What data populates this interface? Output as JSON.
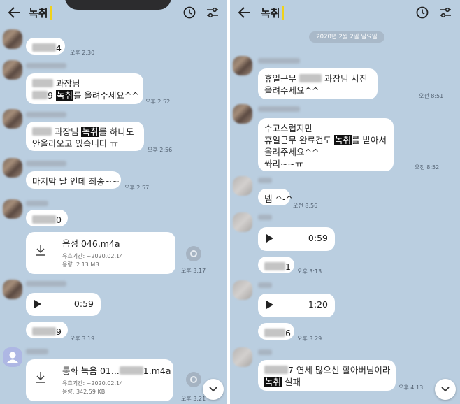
{
  "left": {
    "title": "녹취",
    "messages": {
      "m1": {
        "suffix": "4",
        "time": "오후 2:30"
      },
      "m2": {
        "l1": "과장님",
        "l2_pre": "9 ",
        "hl": "녹취",
        "l2_post": "를 올려주세요^^",
        "time": "오후 2:52"
      },
      "m3": {
        "l1_pre": " 과장님 ",
        "hl": "녹취",
        "l1_post": "를 하나도",
        "l2": "안올라오고 있습니다 ㅠ",
        "time": "오후 2:56"
      },
      "m4": {
        "text": "마지막 날 인데 죄송~~",
        "time": "오후 2:57"
      },
      "m5": {
        "suffix": "0"
      },
      "file1": {
        "name": "음성 046.m4a",
        "expiry": "유효기간: ~2020.02.14",
        "size": "용량: 2.13 MB",
        "time": "오후 3:17"
      },
      "voice1": {
        "duration": "0:59"
      },
      "m6": {
        "suffix": "9",
        "time": "오후 3:19"
      },
      "file2": {
        "name_pre": "통화 녹음 01...",
        "name_post": "1.m4a",
        "expiry": "유효기간: ~2020.02.14",
        "size": "용량: 342.59 KB",
        "time": "오후 3:21"
      }
    }
  },
  "right": {
    "title": "녹취",
    "date": "2020년 2월 2일 일요일",
    "messages": {
      "r1": {
        "l1_pre": "휴일근무 ",
        "l1_post": "과장님 사진",
        "l2": "올려주세요^^",
        "time": "오전 8:51"
      },
      "r2": {
        "l1": "수고스럽지만",
        "l2_pre": "휴일근무 완료건도 ",
        "hl": "녹취",
        "l2_post": "를 받아서",
        "l3": "올려주세요^^",
        "l4": "쏴리~~ㅠ",
        "time": "오전 8:52"
      },
      "r3": {
        "text": "넴 ^-^",
        "time": "오전 8:56"
      },
      "voice1": {
        "duration": "0:59"
      },
      "r4": {
        "suffix": "1",
        "time": "오후 3:13"
      },
      "voice2": {
        "duration": "1:20"
      },
      "r5": {
        "suffix": "6",
        "time": "오후 3:29"
      },
      "r6": {
        "l1_post": "7 연세 많으신 할아버님이라",
        "hl": "녹취",
        "l2_post": " 실패",
        "time": "오후 4:13"
      }
    }
  },
  "icons": [
    "back-arrow-icon",
    "clock-icon",
    "settings-sliders-icon",
    "download-icon",
    "play-icon",
    "share-icon",
    "chevron-down-icon"
  ],
  "colors": {
    "chat_bg": "#bacee0",
    "bubble": "#ffffff",
    "highlight": "#111111",
    "caret": "#f0d21a"
  }
}
